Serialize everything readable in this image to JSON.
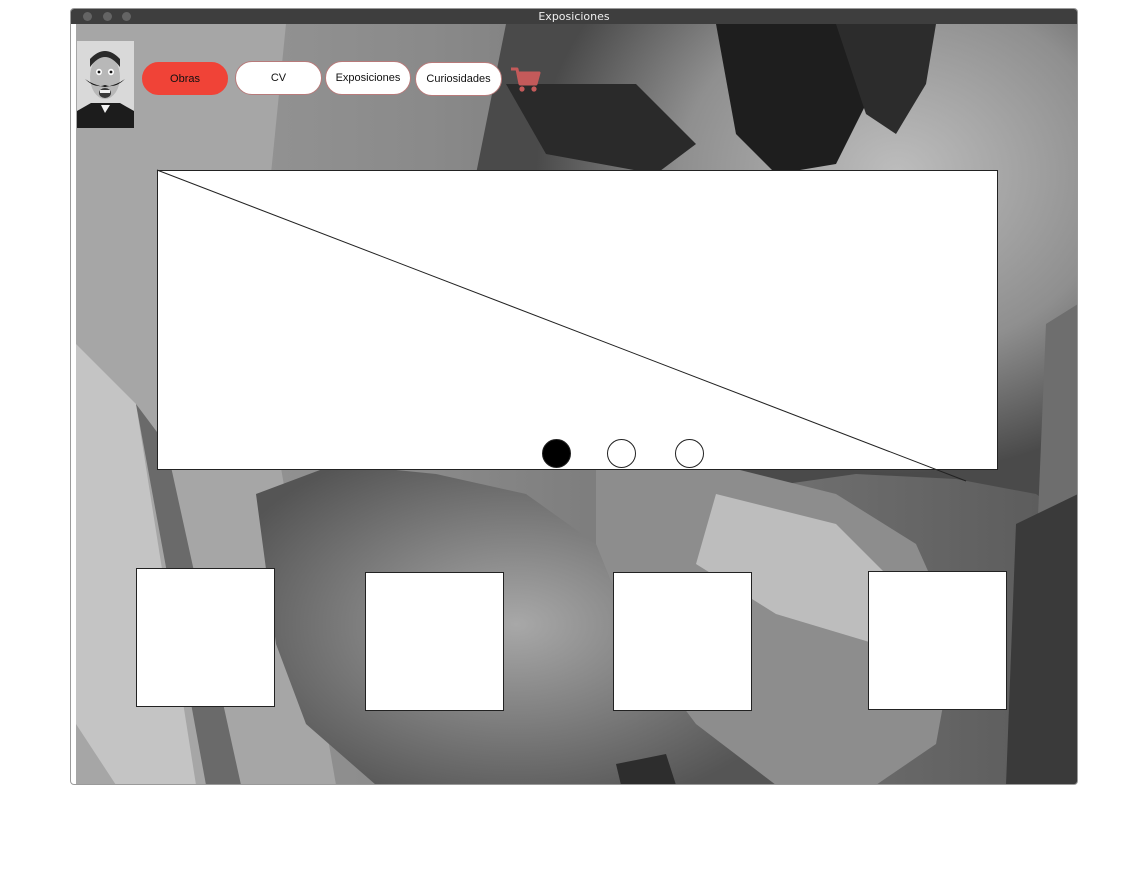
{
  "window": {
    "title": "Exposiciones"
  },
  "nav": {
    "items": [
      {
        "label": "Obras",
        "active": true
      },
      {
        "label": "CV",
        "active": false
      },
      {
        "label": "Exposiciones",
        "active": false
      },
      {
        "label": "Curiosidades",
        "active": false
      }
    ],
    "cart_icon": "shopping-cart-icon"
  },
  "carousel": {
    "slide_count": 3,
    "active_slide": 1
  },
  "gallery": {
    "tile_count": 4
  },
  "colors": {
    "accent": "#f04337",
    "cart": "#c45a5a",
    "titlebar": "#3e3e3e"
  }
}
